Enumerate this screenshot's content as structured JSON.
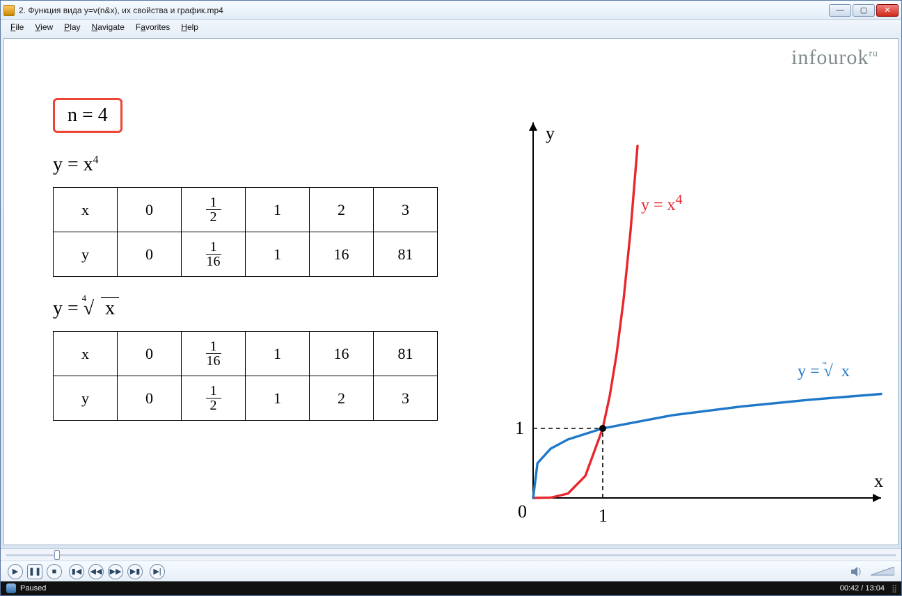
{
  "window": {
    "title": "2. Функция вида y=v(n&x), их свойства и график.mp4"
  },
  "menu": {
    "file": "File",
    "view": "View",
    "play": "Play",
    "navigate": "Navigate",
    "favorites": "Favorites",
    "help": "Help"
  },
  "brand": "infourok",
  "brand_tld": "ru",
  "content": {
    "n_box": "n = 4",
    "eq1_lhs": "y = x",
    "eq1_exp": "4",
    "table1": {
      "row_x_label": "x",
      "row_y_label": "y",
      "x": [
        "0",
        "½",
        "1",
        "2",
        "3"
      ],
      "y": [
        "0",
        "1/16",
        "1",
        "16",
        "81"
      ]
    },
    "eq2_lhs": "y = ",
    "eq2_root_index": "4",
    "eq2_radicand": "x",
    "table2": {
      "row_x_label": "x",
      "row_y_label": "y",
      "x": [
        "0",
        "1/16",
        "1",
        "16",
        "81"
      ],
      "y": [
        "0",
        "½",
        "1",
        "2",
        "3"
      ]
    }
  },
  "chart_data": {
    "type": "line",
    "title": "",
    "x_axis_label": "x",
    "y_axis_label": "y",
    "origin_label": "0",
    "x_tick_labels": [
      "1"
    ],
    "y_tick_labels": [
      "1"
    ],
    "xlim": [
      0,
      5
    ],
    "ylim": [
      0,
      5
    ],
    "series": [
      {
        "name": "y = x⁴",
        "label_html": "y = x<sup>4</sup>",
        "color": "#e8262c",
        "x": [
          0,
          0.25,
          0.5,
          0.75,
          1,
          1.1,
          1.2,
          1.3,
          1.4,
          1.5
        ],
        "values": [
          0,
          0.0039,
          0.0625,
          0.3164,
          1,
          1.4641,
          2.0736,
          2.8561,
          3.8416,
          5.0625
        ]
      },
      {
        "name": "y = ⁴√x",
        "label_html": "y = <sup>4</sup>√x",
        "color": "#1f78c8",
        "x": [
          0,
          0.0625,
          0.25,
          0.5,
          1,
          2,
          3,
          4,
          5
        ],
        "values": [
          0,
          0.5,
          0.707,
          0.841,
          1,
          1.189,
          1.316,
          1.414,
          1.495
        ]
      }
    ],
    "intersection_point": {
      "x": 1,
      "y": 1
    }
  },
  "playback": {
    "status": "Paused",
    "position": "00:42",
    "duration": "13:04",
    "seek_fraction": 0.0536
  },
  "glyph": {
    "play": "▶",
    "pause": "❚❚",
    "stop": "■",
    "prev": "▮◀",
    "back": "◀◀",
    "fwd": "▶▶",
    "next": "▶▮",
    "step": "▶|",
    "min": "—",
    "max": "▢",
    "close": "✕"
  }
}
